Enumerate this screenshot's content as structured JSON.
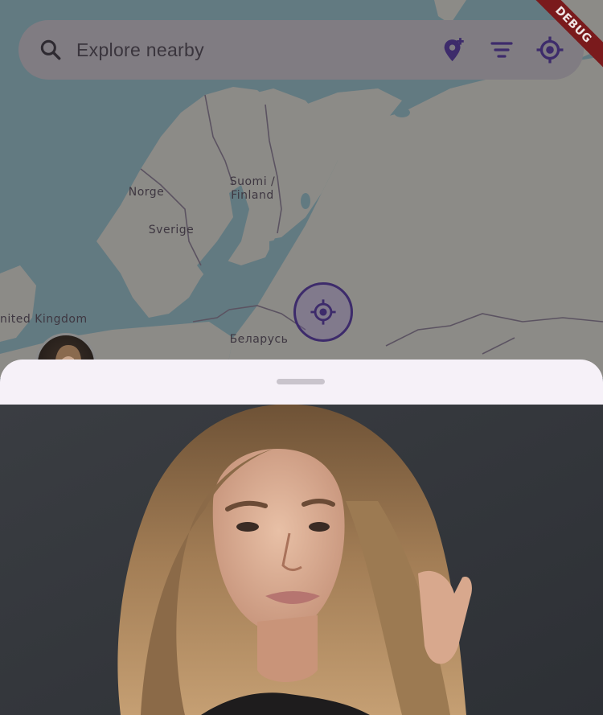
{
  "map": {
    "labels": {
      "norway": "Norge",
      "sweden": "Sverige",
      "finland_line1": "Suomi /",
      "finland_line2": "Finland",
      "uk": "nited Kingdom",
      "belarus": "Беларусь"
    },
    "colors": {
      "water": "#aad3df",
      "land": "#f2efe9",
      "border": "#9e8fa8"
    }
  },
  "search": {
    "placeholder": "Explore nearby",
    "icons": [
      "search-icon",
      "add-location-icon",
      "filter-icon",
      "my-location-icon"
    ]
  },
  "debug_banner": {
    "label": "DEBUG"
  },
  "bottom_sheet": {
    "photo_alt": "Profile photo"
  },
  "theme": {
    "accent": "#3d2b6b",
    "sheet_bg": "#f6f1f8"
  }
}
